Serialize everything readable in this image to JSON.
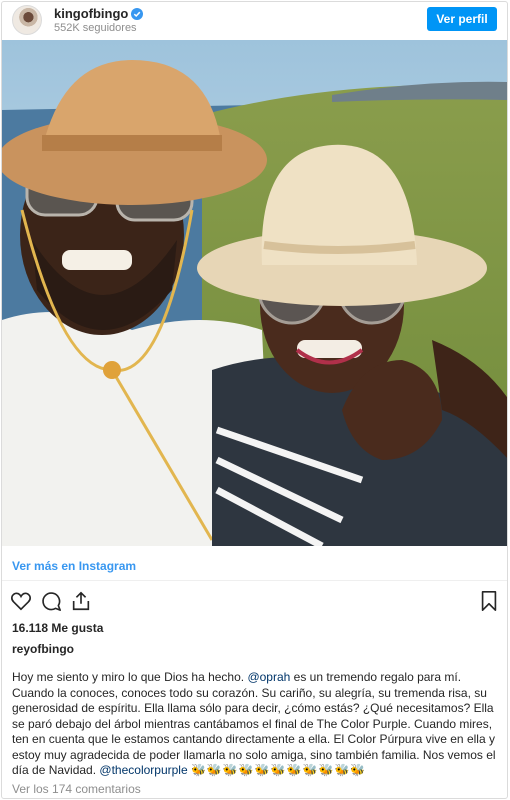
{
  "header": {
    "username": "kingofbingo",
    "followers": "552K seguidores",
    "profile_button": "Ver perfil",
    "verified_icon": "verified-badge-icon"
  },
  "photo": {
    "alt_subject": "two-people-selfie-straw-hats"
  },
  "links": {
    "more_on_instagram": "Ver más en Instagram"
  },
  "actions": {
    "like_icon": "heart-icon",
    "comment_icon": "comment-icon",
    "share_icon": "share-icon",
    "save_icon": "bookmark-icon"
  },
  "post": {
    "likes": "16.118 Me gusta",
    "username": "reyofbingo",
    "caption_part1": "Hoy me siento y miro lo que Dios ha hecho. ",
    "mention1": "@oprah",
    "caption_part2": " es un tremendo regalo para mí. Cuando la conoces, conoces todo su corazón. Su cariño, su alegría, su tremenda risa, su generosidad de espíritu. Ella llama sólo para decir, ¿cómo estás? ¿Qué necesitamos? Ella se paró debajo del árbol mientras cantábamos el final de The Color Purple. Cuando mires, ten en cuenta que le estamos cantando directamente a ella. El Color Púrpura vive en ella y estoy muy agradecida de poder llamarla no solo amiga, sino también familia. Nos vemos el día de Navidad. ",
    "mention2": "@thecolorpurple",
    "emojis": "🐝🐝🐝🐝🐝🐝🐝🐝🐝🐝🐝",
    "comments": "Ver los 174 comentarios"
  },
  "colors": {
    "accent": "#0095f6",
    "link": "#3897f0",
    "mention": "#003569"
  }
}
